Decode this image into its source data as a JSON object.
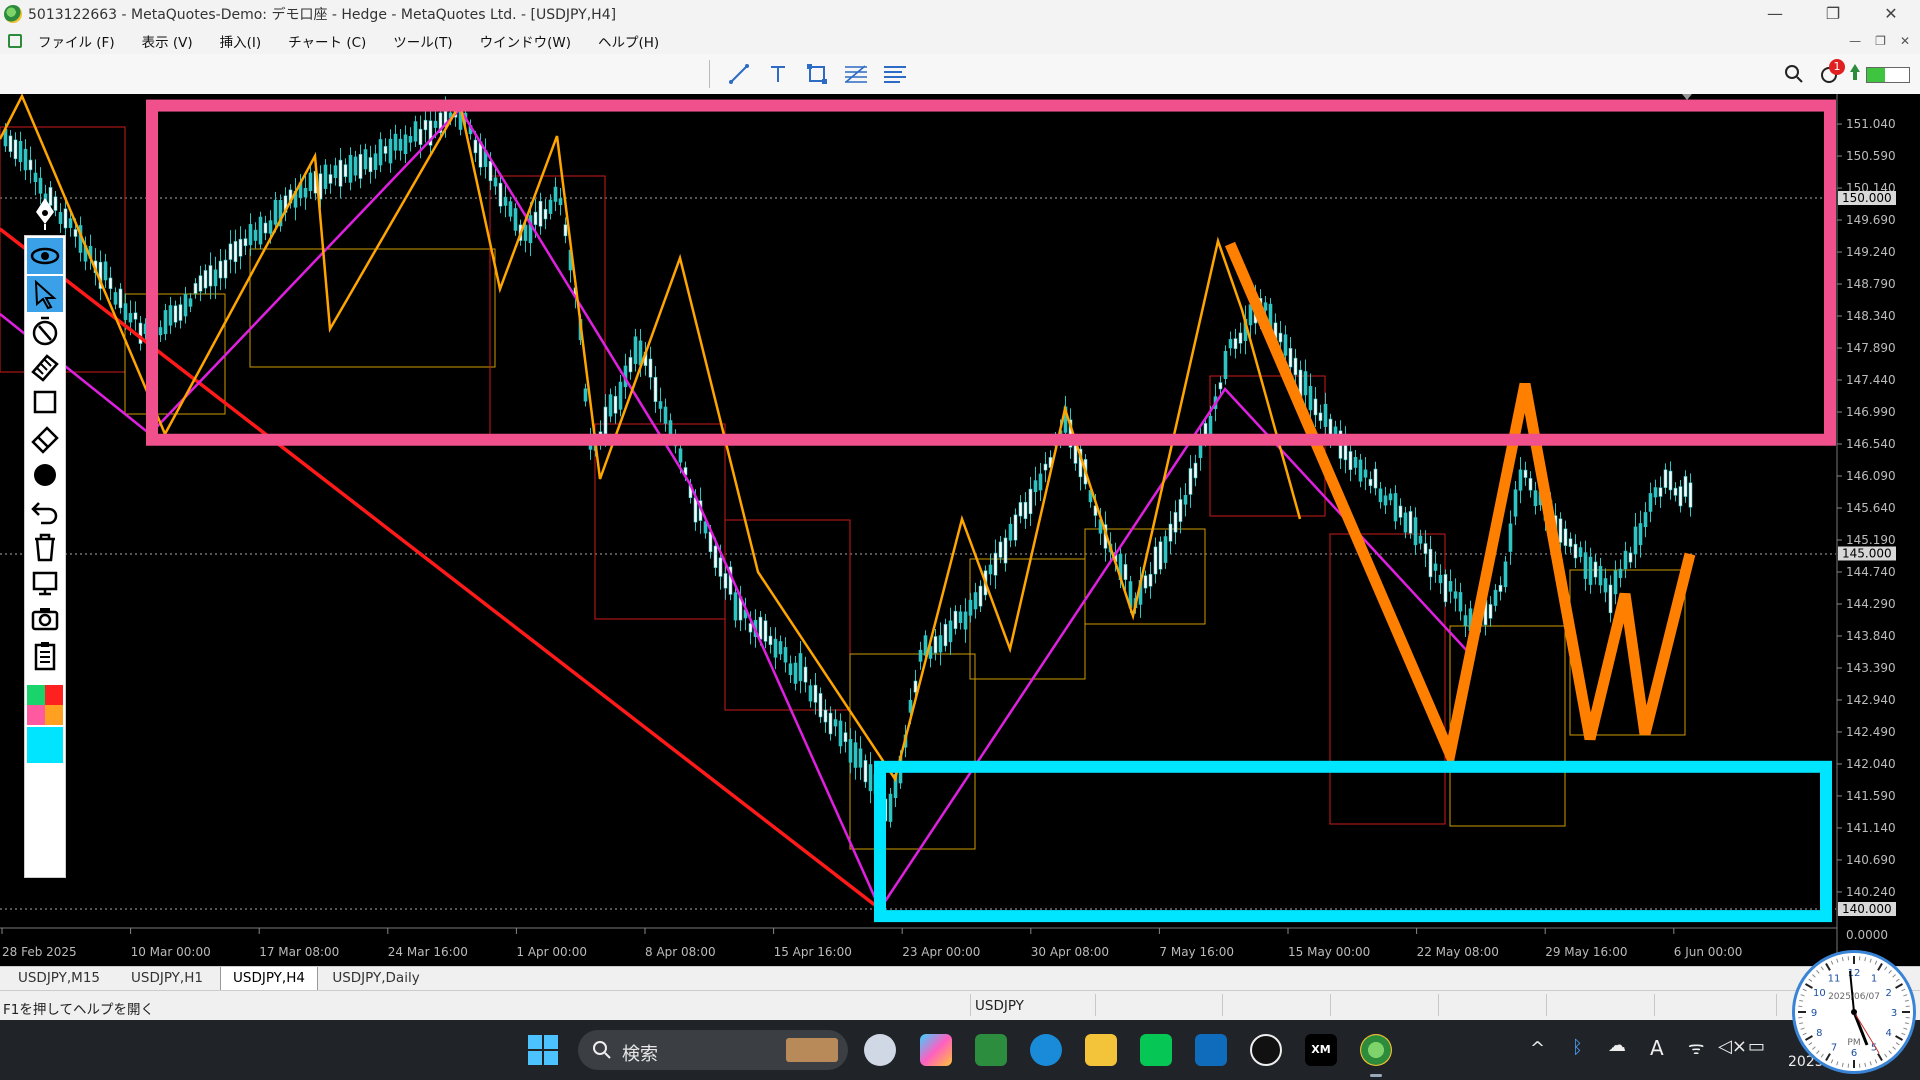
{
  "window": {
    "title": "5013122663 - MetaQuotes-Demo: デモ口座 - Hedge - MetaQuotes Ltd. - [USDJPY,H4]",
    "minimize": "—",
    "maximize": "❐",
    "close": "✕"
  },
  "menu": {
    "items": [
      "ファイル (F)",
      "表示 (V)",
      "挿入(I)",
      "チャート (C)",
      "ツール(T)",
      "ウインドウ(W)",
      "ヘルプ(H)"
    ]
  },
  "toolbar": {
    "icons": [
      "line-tool-icon",
      "text-tool-icon",
      "shape-tool-icon",
      "fibonacci-tool-icon",
      "channel-tool-icon"
    ],
    "notification_count": "1"
  },
  "chart_data": {
    "type": "candlestick",
    "symbol": "USDJPY",
    "timeframe": "H4",
    "y_axis": {
      "ticks": [
        "151.040",
        "150.590",
        "150.140",
        "149.690",
        "149.240",
        "148.790",
        "148.340",
        "147.890",
        "147.440",
        "146.990",
        "146.540",
        "146.090",
        "145.640",
        "145.190",
        "144.740",
        "144.290",
        "143.840",
        "143.390",
        "142.940",
        "142.490",
        "142.040",
        "141.590",
        "141.140",
        "140.690",
        "140.240"
      ],
      "price_labels": [
        "150.000",
        "145.000",
        "140.000"
      ],
      "indicator_zero": "0.0000"
    },
    "x_axis": {
      "ticks": [
        "28 Feb 2025",
        "10 Mar 00:00",
        "17 Mar 08:00",
        "24 Mar 16:00",
        "1 Apr 00:00",
        "8 Apr 08:00",
        "15 Apr 16:00",
        "23 Apr 00:00",
        "30 Apr 08:00",
        "7 May 16:00",
        "15 May 00:00",
        "22 May 08:00",
        "29 May 16:00",
        "6 Jun 00:00"
      ]
    },
    "zones": [
      {
        "color": "#f0508c",
        "price_top": 151.3,
        "price_bottom": 146.6
      },
      {
        "color": "#00e5ff",
        "price_top": 142.0,
        "price_bottom": 139.9
      }
    ],
    "colors": {
      "zigzag_fast": "#ffa500",
      "zigzag_slow": "#e020e0",
      "trendline": "#ff1a1a",
      "forecast": "#ff7f00",
      "candles": "#2ec4c4"
    }
  },
  "palette": {
    "tools": [
      "pen-icon",
      "eye-icon",
      "cursor-icon",
      "stopwatch-icon",
      "ruler-icon",
      "rectangle-icon",
      "eraser-icon",
      "dot-icon",
      "undo-icon",
      "trash-icon",
      "monitor-icon",
      "camera-icon",
      "clipboard-icon"
    ]
  },
  "tabs": [
    "USDJPY,M15",
    "USDJPY,H1",
    "USDJPY,H4",
    "USDJPY,Daily"
  ],
  "active_tab": "USDJPY,H4",
  "status": {
    "help": "F1を押してヘルプを開く",
    "symbol": "USDJPY"
  },
  "taskbar": {
    "search_label": "検索",
    "clock_date": "2025/06/07",
    "clock_ampm": "PM",
    "clock_year": "2025"
  }
}
